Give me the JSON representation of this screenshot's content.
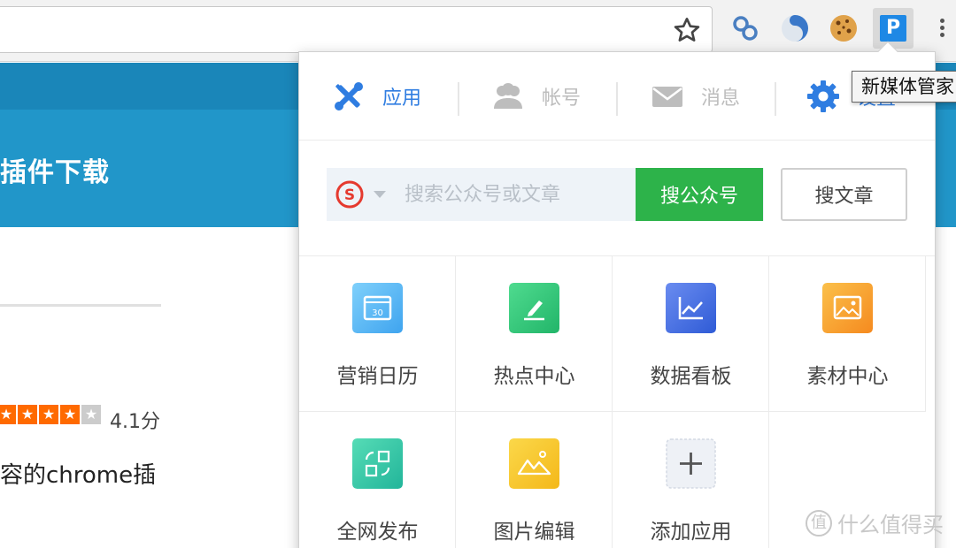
{
  "page": {
    "hero_title": "插件下载",
    "rating_text": "4.1分",
    "rating_value": 4.1,
    "rating_max": 5,
    "description": "容的chrome插"
  },
  "tooltip": "新媒体管家",
  "popup": {
    "nav": [
      {
        "label": "应用",
        "icon": "tools-icon",
        "active": true
      },
      {
        "label": "帐号",
        "icon": "users-icon",
        "active": false
      },
      {
        "label": "消息",
        "icon": "mail-icon",
        "active": false
      },
      {
        "label": "设置",
        "icon": "gear-icon",
        "active": false
      }
    ],
    "search": {
      "engine_icon": "sogou-icon",
      "placeholder": "搜索公众号或文章",
      "search_account_label": "搜公众号",
      "search_article_label": "搜文章"
    },
    "apps": [
      {
        "label": "营销日历",
        "icon": "calendar-icon",
        "icon_value": "30",
        "color": "#59b8f5"
      },
      {
        "label": "热点中心",
        "icon": "pen-icon",
        "color": "#2ec47a"
      },
      {
        "label": "数据看板",
        "icon": "chart-icon",
        "color": "#3f6fe0"
      },
      {
        "label": "素材中心",
        "icon": "image-icon",
        "color": "#f7a12f"
      },
      {
        "label": "全网发布",
        "icon": "publish-icon",
        "color": "#35c9a8"
      },
      {
        "label": "图片编辑",
        "icon": "mountain-icon",
        "color": "#f5c52a"
      },
      {
        "label": "添加应用",
        "icon": "plus-icon",
        "color": "#eef1f6"
      }
    ]
  },
  "watermark": "什么值得买",
  "colors": {
    "brand_blue": "#1e88e5",
    "active_nav": "#2f7de1",
    "search_green": "#2db34a",
    "hero_blue": "#2196c9"
  }
}
